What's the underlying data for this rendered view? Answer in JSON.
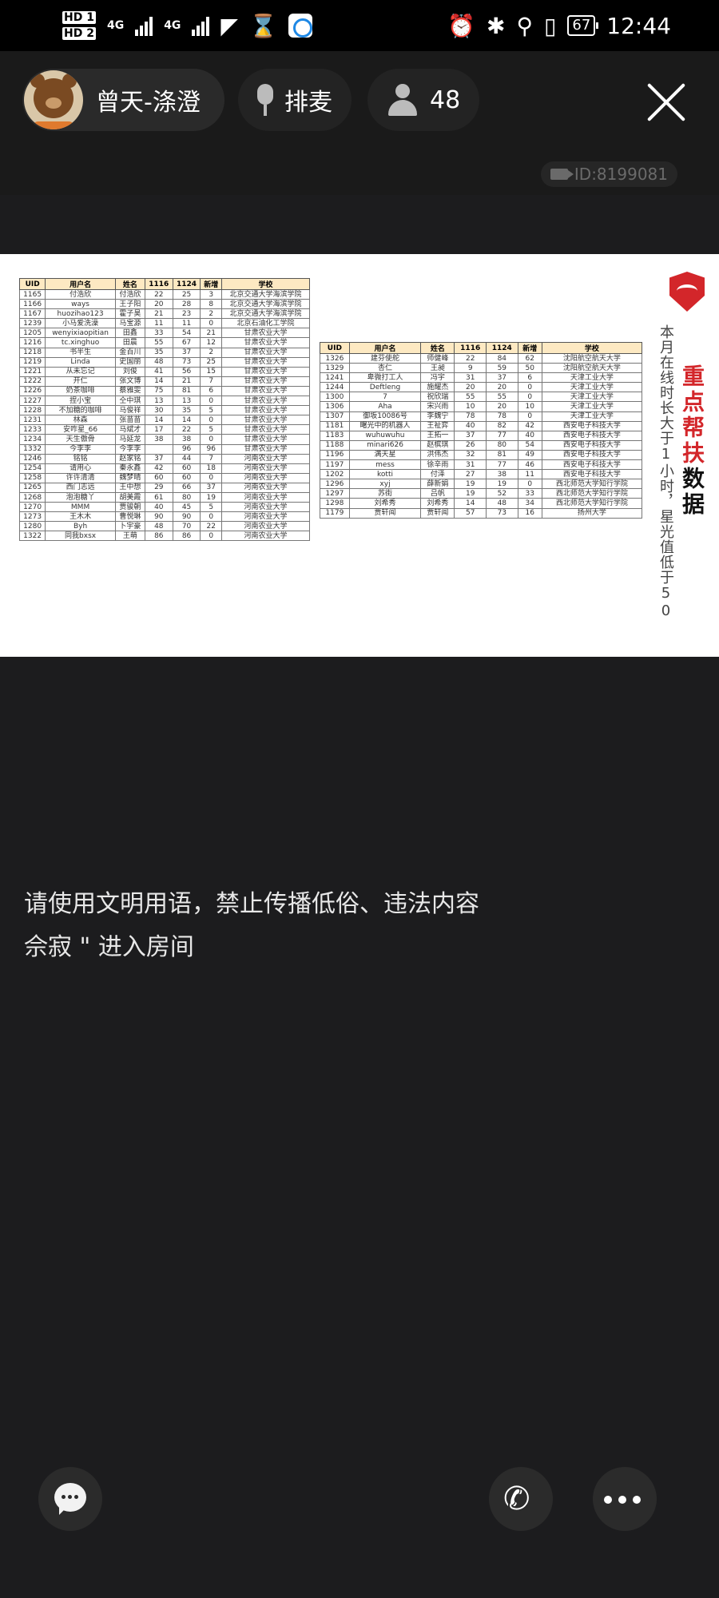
{
  "status_bar": {
    "hd1": "HD 1",
    "hd2": "HD 2",
    "net1": "4G",
    "net2": "4G",
    "battery": "67",
    "time": "12:44"
  },
  "header": {
    "host_name": "曾天-涤澄",
    "queue_label": "排麦",
    "audience_count": "48",
    "room_id": "ID:8199081"
  },
  "slide": {
    "side_note": "本月在线时长大于1小时，星光值低于50",
    "headline_red": "重点帮扶",
    "headline_black": "数据",
    "columns": [
      "UID",
      "用户名",
      "姓名",
      "1116",
      "1124",
      "新增",
      "学校"
    ],
    "table_left": [
      [
        "1165",
        "付浩欣",
        "付浩欣",
        "22",
        "25",
        "3",
        "北京交通大学海滨学院"
      ],
      [
        "1166",
        "ways",
        "王子阳",
        "20",
        "28",
        "8",
        "北京交通大学海滨学院"
      ],
      [
        "1167",
        "huozihao123",
        "霍子昊",
        "21",
        "23",
        "2",
        "北京交通大学海滨学院"
      ],
      [
        "1239",
        "小马爱洗澡",
        "马宝源",
        "11",
        "11",
        "0",
        "北京石油化工学院"
      ],
      [
        "1205",
        "wenyixiaopitian",
        "田鑫",
        "33",
        "54",
        "21",
        "甘肃农业大学"
      ],
      [
        "1216",
        "tc.xinghuo",
        "田晨",
        "55",
        "67",
        "12",
        "甘肃农业大学"
      ],
      [
        "1218",
        "书半生",
        "金百川",
        "35",
        "37",
        "2",
        "甘肃农业大学"
      ],
      [
        "1219",
        "Linda",
        "史国丽",
        "48",
        "73",
        "25",
        "甘肃农业大学"
      ],
      [
        "1221",
        "从未忘记",
        "刘俊",
        "41",
        "56",
        "15",
        "甘肃农业大学"
      ],
      [
        "1222",
        "开仁",
        "张文博",
        "14",
        "21",
        "7",
        "甘肃农业大学"
      ],
      [
        "1226",
        "奶茶咖啡",
        "蔡雅雯",
        "75",
        "81",
        "6",
        "甘肃农业大学"
      ],
      [
        "1227",
        "捏小宝",
        "仝中琪",
        "13",
        "13",
        "0",
        "甘肃农业大学"
      ],
      [
        "1228",
        "不加糖的咖啡",
        "马俊祥",
        "30",
        "35",
        "5",
        "甘肃农业大学"
      ],
      [
        "1231",
        "林森",
        "张苗苗",
        "14",
        "14",
        "0",
        "甘肃农业大学"
      ],
      [
        "1233",
        "安咋星_66",
        "马斌才",
        "17",
        "22",
        "5",
        "甘肃农业大学"
      ],
      [
        "1234",
        "天生傲骨",
        "马延龙",
        "38",
        "38",
        "0",
        "甘肃农业大学"
      ],
      [
        "1332",
        "今李李",
        "今李李",
        "",
        "96",
        "96",
        "甘肃农业大学"
      ],
      [
        "1246",
        "铭铭",
        "赵家铭",
        "37",
        "44",
        "7",
        "河南农业大学"
      ],
      [
        "1254",
        "请用心",
        "秦永鑫",
        "42",
        "60",
        "18",
        "河南农业大学"
      ],
      [
        "1258",
        "许许清清",
        "魏梦晴",
        "60",
        "60",
        "0",
        "河南农业大学"
      ],
      [
        "1265",
        "西门志远",
        "王中想",
        "29",
        "66",
        "37",
        "河南农业大学"
      ],
      [
        "1268",
        "泡泡糖丫",
        "胡美霞",
        "61",
        "80",
        "19",
        "河南农业大学"
      ],
      [
        "1270",
        "MMM",
        "贾骏朝",
        "40",
        "45",
        "5",
        "河南农业大学"
      ],
      [
        "1273",
        "王木木",
        "曹悦琳",
        "90",
        "90",
        "0",
        "河南农业大学"
      ],
      [
        "1280",
        "Byh",
        "卜宇豪",
        "48",
        "70",
        "22",
        "河南农业大学"
      ],
      [
        "1322",
        "同我bxsx",
        "王萌",
        "86",
        "86",
        "0",
        "河南农业大学"
      ]
    ],
    "table_right": [
      [
        "1326",
        "建芬使舵",
        "师健峰",
        "22",
        "84",
        "62",
        "沈阳航空航天大学"
      ],
      [
        "1329",
        "杏仁",
        "王昶",
        "9",
        "59",
        "50",
        "沈阳航空航天大学"
      ],
      [
        "1241",
        "卑微打工人",
        "冯宇",
        "31",
        "37",
        "6",
        "天津工业大学"
      ],
      [
        "1244",
        "Deftleng",
        "施耀杰",
        "20",
        "20",
        "0",
        "天津工业大学"
      ],
      [
        "1300",
        "7",
        "祝欣瑞",
        "55",
        "55",
        "0",
        "天津工业大学"
      ],
      [
        "1306",
        "Aha",
        "宋兴雨",
        "10",
        "20",
        "10",
        "天津工业大学"
      ],
      [
        "1307",
        "御坂10086号",
        "李魏宁",
        "78",
        "78",
        "0",
        "天津工业大学"
      ],
      [
        "1181",
        "曙光中的机器人",
        "王祉弈",
        "40",
        "82",
        "42",
        "西安电子科技大学"
      ],
      [
        "1183",
        "wuhuwuhu",
        "王拓一",
        "37",
        "77",
        "40",
        "西安电子科技大学"
      ],
      [
        "1188",
        "minari626",
        "赵槟琪",
        "26",
        "80",
        "54",
        "西安电子科技大学"
      ],
      [
        "1196",
        "满天星",
        "洪伟杰",
        "32",
        "81",
        "49",
        "西安电子科技大学"
      ],
      [
        "1197",
        "mess",
        "徐辛雨",
        "31",
        "77",
        "46",
        "西安电子科技大学"
      ],
      [
        "1202",
        "kotti",
        "付泽",
        "27",
        "38",
        "11",
        "西安电子科技大学"
      ],
      [
        "1296",
        "xyj",
        "薛新娟",
        "19",
        "19",
        "0",
        "西北师范大学知行学院"
      ],
      [
        "1297",
        "苏街",
        "吕帆",
        "19",
        "52",
        "33",
        "西北师范大学知行学院"
      ],
      [
        "1298",
        "刘希秀",
        "刘希秀",
        "14",
        "48",
        "34",
        "西北师范大学知行学院"
      ],
      [
        "1179",
        "贾轩闻",
        "贾轩闻",
        "57",
        "73",
        "16",
        "扬州大学"
      ]
    ]
  },
  "chat": {
    "system_notice": "请使用文明用语，禁止传播低俗、违法内容",
    "join_message": "佘寂 \" 进入房间"
  },
  "icons": {
    "chat": "chat-bubble-icon",
    "call": "phone-icon",
    "more": "more-dots-icon",
    "close": "close-icon"
  }
}
